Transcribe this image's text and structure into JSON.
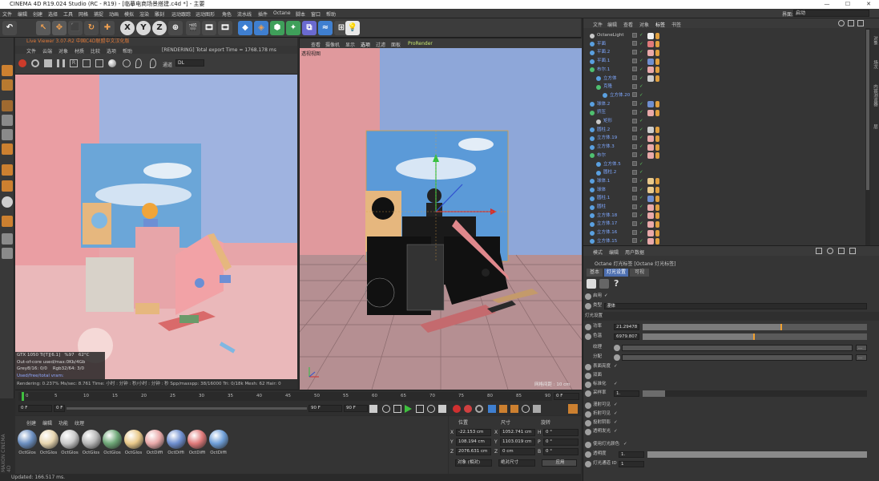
{
  "titlebar": {
    "title": "CINEMA 4D R19.024 Studio (RC - R19) - [临摹电商场景搭建.c4d *] - 主要",
    "min": "—",
    "max": "☐",
    "close": "✕"
  },
  "menubar": {
    "items": [
      "文件",
      "编辑",
      "创建",
      "选择",
      "工具",
      "网格",
      "捕捉",
      "动画",
      "模拟",
      "渲染",
      "雕刻",
      "运动跟踪",
      "运动图形",
      "角色",
      "流水线",
      "插件",
      "Octane",
      "脚本",
      "窗口",
      "帮助"
    ],
    "layout_label": "界面:",
    "layout_value": "启动"
  },
  "toolbar": {
    "buttons": [
      "↶",
      "↖",
      "✥",
      "⬛",
      "↻",
      "✚",
      "X",
      "Y",
      "Z",
      "⊕",
      "🎬",
      "🎞",
      "🎞",
      "◆",
      "◈",
      "⬢",
      "✦",
      "⧉",
      "≈",
      "⊞",
      "💡"
    ]
  },
  "live_viewer": {
    "title": "Live Viewer 3.07-R2 中国C4D联盟中文汉化版",
    "menu": [
      "文件",
      "云端",
      "对象",
      "材质",
      "比较",
      "选项",
      "帮助"
    ],
    "status": "[RENDERING] Total export Time = 1768.178 ms",
    "channel_label": "通道",
    "channel_value": "DL",
    "overlay": {
      "gpu": "GTX 1050 Ti[T][6.1]",
      "gpu_pct": "%97",
      "gpu_temp": "62°C",
      "ooc": "Out-of-core used/max:0Kb/4Gb",
      "grey": "Grey8/16: 0/0",
      "rgb": "Rgb32/64: 3/0",
      "vram": "Used/free/total vram: 560Mb/2.602Gb/4Gb"
    },
    "footer": {
      "rendering": "Rendering: 0.237%",
      "ms": "Ms/sec: 8.761",
      "time": "Time: 小时 : 分钟 : 秒/小时 : 分钟 : 秒",
      "spp": "Spp/maxspp: 38/16000",
      "tri": "Tri: 0/18k",
      "mesh": "Mesh: 62",
      "hair": "Hair: 0"
    }
  },
  "viewport": {
    "menu": [
      "查看",
      "摄像机",
      "显示",
      "选项",
      "过滤",
      "面板",
      "ProRender"
    ],
    "label": "透视视图",
    "grid": "网格间距 : 10 cm"
  },
  "timeline": {
    "ticks": [
      "0",
      "5",
      "10",
      "15",
      "20",
      "25",
      "30",
      "35",
      "40",
      "45",
      "50",
      "55",
      "60",
      "65",
      "70",
      "75",
      "80",
      "85",
      "90"
    ],
    "frame_end": "0 F",
    "start": "0 F",
    "start2": "0 F",
    "end": "90 F",
    "end2": "90 F"
  },
  "materials": {
    "tabs": [
      "创建",
      "编辑",
      "功能",
      "纹理"
    ],
    "items": [
      {
        "label": "OctGlos",
        "color": "#6c8fc0"
      },
      {
        "label": "OctGlos",
        "color": "#e8d6b0"
      },
      {
        "label": "OctGlos",
        "color": "#c9c9c9"
      },
      {
        "label": "OctGlos",
        "color": "#b8b8b8"
      },
      {
        "label": "OctGlos",
        "color": "#6fa878"
      },
      {
        "label": "OctGlos",
        "color": "#e9c98a"
      },
      {
        "label": "OctDiffi",
        "color": "#e9a9a9"
      },
      {
        "label": "OctDiffi",
        "color": "#6f8fd0"
      },
      {
        "label": "OctDiffi",
        "color": "#e07a7a"
      },
      {
        "label": "OctDiffi",
        "color": "#6f9fd8"
      }
    ]
  },
  "coordinates": {
    "headers": [
      "位置",
      "尺寸",
      "旋转"
    ],
    "rows": [
      {
        "axis": "X",
        "pos": "-22.153 cm",
        "saxis": "X",
        "size": "1052.741 cm",
        "raxis": "H",
        "rot": "0 °"
      },
      {
        "axis": "Y",
        "pos": "108.194 cm",
        "saxis": "Y",
        "size": "1103.019 cm",
        "raxis": "P",
        "rot": "0 °"
      },
      {
        "axis": "Z",
        "pos": "2076.631 cm",
        "saxis": "Z",
        "size": "0 cm",
        "raxis": "B",
        "rot": "0 °"
      }
    ],
    "mode1": "对象 (相对)",
    "mode2": "绝对尺寸",
    "apply": "应用"
  },
  "status": {
    "text": "Updated: 166.517 ms."
  },
  "object_manager": {
    "menu": [
      "文件",
      "编辑",
      "查看",
      "对象",
      "标签",
      "书签"
    ],
    "objects": [
      {
        "name": "OctaneLight",
        "indent": 0,
        "icon": "#c9c9c9",
        "tag": "#f0f0f0"
      },
      {
        "name": "平面",
        "indent": 0,
        "icon": "#5aa0e0",
        "tag": "#e07a7a"
      },
      {
        "name": "平面.2",
        "indent": 0,
        "icon": "#5aa0e0",
        "tag": "#e9a9a9"
      },
      {
        "name": "平面.1",
        "indent": 0,
        "icon": "#5aa0e0",
        "tag": "#6f8fd0"
      },
      {
        "name": "布尔.1",
        "indent": 0,
        "icon": "#4fc070",
        "tag": "#e9a9a9"
      },
      {
        "name": "立方体",
        "indent": 1,
        "icon": "#5aa0e0",
        "tag": "#cccccc"
      },
      {
        "name": "克隆",
        "indent": 1,
        "icon": "#4fc070",
        "tag": ""
      },
      {
        "name": "立方体.20",
        "indent": 2,
        "icon": "#5aa0e0",
        "tag": ""
      },
      {
        "name": "球体.2",
        "indent": 0,
        "icon": "#5aa0e0",
        "tag": "#6f8fd0"
      },
      {
        "name": "挤压",
        "indent": 0,
        "icon": "#4fc070",
        "tag": "#e9a9a9"
      },
      {
        "name": "矩形",
        "indent": 1,
        "icon": "#c9c9c9",
        "tag": ""
      },
      {
        "name": "圆柱.2",
        "indent": 0,
        "icon": "#5aa0e0",
        "tag": "#cccccc"
      },
      {
        "name": "立方体.19",
        "indent": 0,
        "icon": "#5aa0e0",
        "tag": "#e9a9a9"
      },
      {
        "name": "立方体.3",
        "indent": 0,
        "icon": "#5aa0e0",
        "tag": "#e9a9a9"
      },
      {
        "name": "布尔",
        "indent": 0,
        "icon": "#4fc070",
        "tag": "#e9a9a9"
      },
      {
        "name": "立方体.5",
        "indent": 1,
        "icon": "#5aa0e0",
        "tag": ""
      },
      {
        "name": "圆柱.2",
        "indent": 1,
        "icon": "#5aa0e0",
        "tag": ""
      },
      {
        "name": "球体.1",
        "indent": 0,
        "icon": "#5aa0e0",
        "tag": "#e9c98a"
      },
      {
        "name": "球体",
        "indent": 0,
        "icon": "#5aa0e0",
        "tag": "#e9c98a"
      },
      {
        "name": "圆柱.1",
        "indent": 0,
        "icon": "#5aa0e0",
        "tag": "#6f8fd0"
      },
      {
        "name": "圆柱",
        "indent": 0,
        "icon": "#5aa0e0",
        "tag": "#e9a9a9"
      },
      {
        "name": "立方体.18",
        "indent": 0,
        "icon": "#5aa0e0",
        "tag": "#e9a9a9"
      },
      {
        "name": "立方体.17",
        "indent": 0,
        "icon": "#5aa0e0",
        "tag": "#e9a9a9"
      },
      {
        "name": "立方体.16",
        "indent": 0,
        "icon": "#5aa0e0",
        "tag": "#e9a9a9"
      },
      {
        "name": "立方体.15",
        "indent": 0,
        "icon": "#5aa0e0",
        "tag": "#e9a9a9"
      }
    ]
  },
  "attributes": {
    "menu": [
      "模式",
      "编辑",
      "用户数据"
    ],
    "title": "Octane 灯光标签 [Octane 灯光标签]",
    "tabs": [
      "基本",
      "灯光设置",
      "可视"
    ],
    "enable_label": "启用",
    "enable_check": "✓",
    "type_label": "类型",
    "type_value": "漫体",
    "section": "灯光设置",
    "rows": [
      {
        "label": "功率",
        "value": "21.29478",
        "fill": 0.62
      },
      {
        "label": "色温",
        "value": "6979.807",
        "fill": 0.5
      }
    ],
    "texture_label": "纹理",
    "distribution_label": "分配",
    "checks": [
      {
        "label": "表面亮度",
        "value": "✓"
      },
      {
        "label": "双面",
        "value": ""
      },
      {
        "label": "标准化",
        "value": "✓"
      }
    ],
    "sampling_label": "采样率",
    "sampling_value": "1.",
    "visibility": [
      {
        "label": "漫射可见",
        "value": "✓"
      },
      {
        "label": "折射可见",
        "value": "✓"
      },
      {
        "label": "投射阴影",
        "value": "✓"
      },
      {
        "label": "透明发光",
        "value": "✓"
      }
    ],
    "use_light_color_label": "使用灯光颜色",
    "use_light_color_value": "✓",
    "transparency_label": "透明度",
    "transparency_value": "1.",
    "light_id_label": "灯光通道 ID",
    "light_id_value": "1"
  }
}
